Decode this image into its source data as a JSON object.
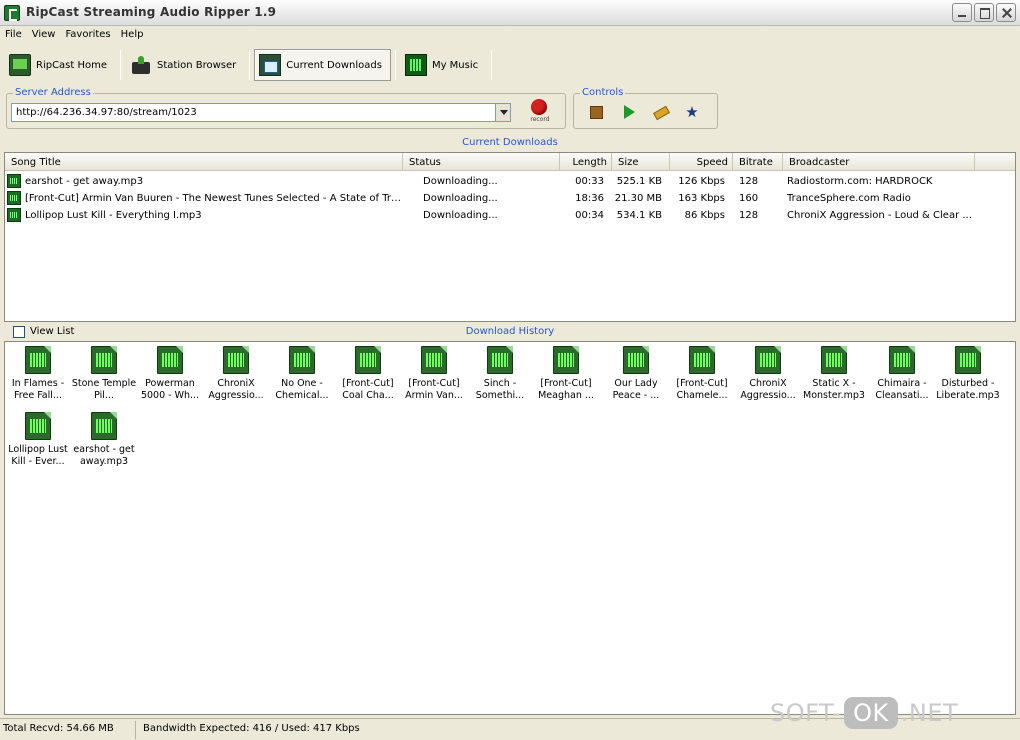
{
  "window": {
    "title": "RipCast Streaming Audio Ripper 1.9"
  },
  "menu": [
    "File",
    "View",
    "Favorites",
    "Help"
  ],
  "toolbar": {
    "home": "RipCast Home",
    "station": "Station Browser",
    "downloads": "Current Downloads",
    "music": "My Music"
  },
  "server": {
    "legend": "Server Address",
    "value": "http://64.236.34.97:80/stream/1023",
    "record_label": "record"
  },
  "controls": {
    "legend": "Controls"
  },
  "current": {
    "title": "Current Downloads",
    "columns": [
      "Song Title",
      "Status",
      "Length",
      "Size",
      "Speed",
      "Bitrate",
      "Broadcaster"
    ],
    "rows": [
      [
        "earshot - get away.mp3",
        "Downloading...",
        "00:33",
        "525.1 KB",
        "126 Kbps",
        "128",
        "Radiostorm.com: HARDROCK"
      ],
      [
        "[Front-Cut] Armin Van Buuren - The Newest Tunes Selected - A State of Tra...",
        "Downloading...",
        "18:36",
        "21.30 MB",
        "163 Kbps",
        "160",
        "TranceSphere.com Radio"
      ],
      [
        "Lollipop Lust Kill - Everything I.mp3",
        "Downloading...",
        "00:34",
        "534.1 KB",
        "86 Kbps",
        "128",
        "ChroniX Aggression - Loud & Clear ..."
      ]
    ]
  },
  "history": {
    "viewlist": "View List",
    "title": "Download History",
    "items": [
      "In Flames - Free Fall...",
      "Stone Temple Pil...",
      "Powerman 5000 - Wh...",
      "ChroniX Aggressio...",
      "No One - Chemical...",
      "[Front-Cut] Coal Cha...",
      "[Front-Cut] Armin Van...",
      "Sinch - Somethi...",
      "[Front-Cut] Meaghan ...",
      "Our Lady Peace - ...",
      "[Front-Cut] Chamele...",
      "ChroniX Aggressio...",
      "Static X - Monster.mp3",
      "Chimaira - Cleansati...",
      "Disturbed - Liberate.mp3",
      "Lollipop Lust Kill - Ever...",
      "earshot - get away.mp3"
    ]
  },
  "status": {
    "total": "Total Recvd: 54.66 MB",
    "bandwidth": "Bandwidth Expected: 416 / Used: 417 Kbps"
  },
  "watermark": {
    "left": "SOFT-",
    "mid": "OK",
    "right": ".NET"
  }
}
